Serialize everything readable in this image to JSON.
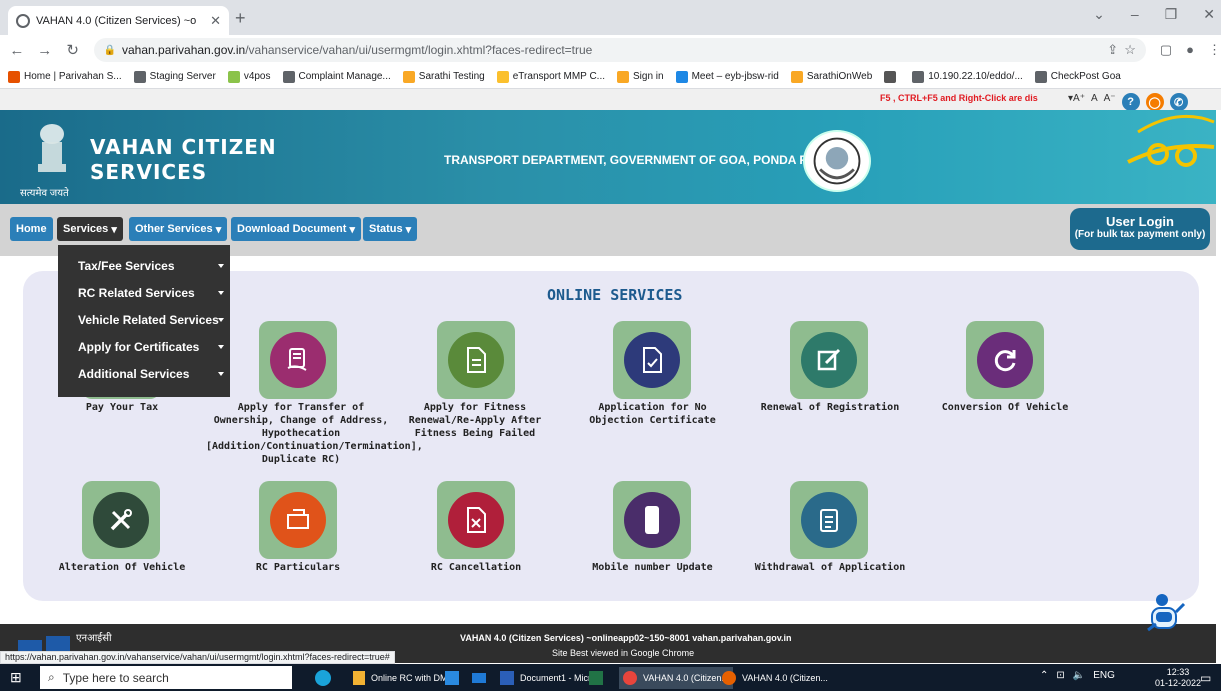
{
  "browser": {
    "tab_title": "VAHAN 4.0 (Citizen Services) ~o",
    "url_host": "vahan.parivahan.gov.in",
    "url_path": "/vahanservice/vahan/ui/usermgmt/login.xhtml?faces-redirect=true",
    "bookmarks": [
      {
        "label": "Home | Parivahan S...",
        "color": "#e65100"
      },
      {
        "label": "Staging Server",
        "color": "#5f6368"
      },
      {
        "label": "v4pos",
        "color": "#8bc34a"
      },
      {
        "label": "Complaint Manage...",
        "color": "#5f6368"
      },
      {
        "label": "Sarathi Testing",
        "color": "#f9a825"
      },
      {
        "label": "eTransport MMP C...",
        "color": "#fbc02d"
      },
      {
        "label": "Sign in",
        "color": "#f9a825"
      },
      {
        "label": "Meet – eyb-jbsw-rid",
        "color": "#1e88e5"
      },
      {
        "label": "SarathiOnWeb",
        "color": "#f9a825"
      },
      {
        "label": "",
        "color": "#555"
      },
      {
        "label": "10.190.22.10/eddo/...",
        "color": "#5f6368"
      },
      {
        "label": "CheckPost Goa",
        "color": "#5f6368"
      }
    ]
  },
  "util": {
    "warning": "F5 , CTRL+F5 and Right-Click are dis",
    "font_controls": [
      "▾A⁺",
      "A",
      "A⁻"
    ]
  },
  "header": {
    "emblem_text": "सत्यमेव जयते",
    "brand_line1": "VAHAN CITIZEN",
    "brand_line2": "SERVICES",
    "department": "TRANSPORT DEPARTMENT, GOVERNMENT OF GOA, PONDA RTO"
  },
  "nav": {
    "items": [
      "Home",
      "Services",
      "Other Services",
      "Download Document",
      "Status"
    ],
    "user_login": "User Login",
    "user_login_sub": "(For bulk tax payment only)"
  },
  "dropdown": [
    "Tax/Fee Services",
    "RC Related Services",
    "Vehicle Related Services",
    "Apply for Certificates",
    "Additional Services"
  ],
  "main": {
    "title": "ONLINE SERVICES",
    "services_row1": [
      "Pay Your Tax",
      "Apply for Transfer of Ownership, Change of Address, Hypothecation [Addition/Continuation/Termination], Duplicate RC)",
      "Apply for Fitness Renewal/Re-Apply After Fitness Being Failed",
      "Application for No Objection Certificate",
      "Renewal of Registration",
      "Conversion Of Vehicle"
    ],
    "services_row2": [
      "Alteration Of Vehicle",
      "RC Particulars",
      "RC Cancellation",
      "Mobile number Update",
      "Withdrawal of Application"
    ]
  },
  "footer": {
    "line1": "VAHAN 4.0 (Citizen Services) ~onlineapp02~150~8001 vahan.parivahan.gov.in",
    "line2": "Site Best viewed in Google Chrome",
    "nic": "एनआईसी",
    "status_url": "https://vahan.parivahan.gov.in/vahanservice/vahan/ui/usermgmt/login.xhtml?faces-redirect=true#"
  },
  "taskbar": {
    "search_placeholder": "Type here to search",
    "apps": [
      "Online RC with DM...",
      "Document1 - Micr...",
      "VAHAN 4.0 (Citizen...",
      "VAHAN 4.0 (Citizen..."
    ],
    "lang": "ENG",
    "time": "12:33",
    "date": "01-12-2022"
  },
  "colors": {
    "nav_blue": "#2b7fb8",
    "card_green": "#8fbc8f",
    "title_blue": "#1d5a8e",
    "warning_red": "#e11b22"
  }
}
